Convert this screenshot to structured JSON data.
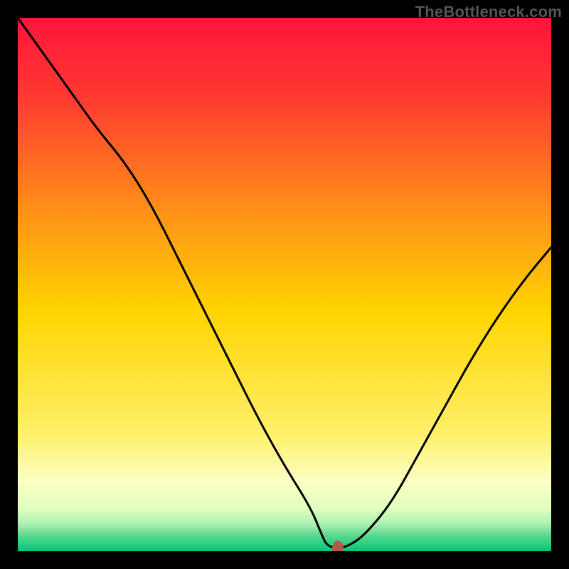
{
  "watermark": "TheBottleneck.com",
  "colors": {
    "top": "#ff143c",
    "upper_mid": "#ff7a1a",
    "mid": "#ffd400",
    "lower_mid": "#fff58a",
    "low_yellow": "#fcffc4",
    "pale": "#e8ffc8",
    "light_green": "#9cf0b0",
    "green": "#00c878",
    "frame": "#000000",
    "curve": "#000000",
    "marker": "#b4594a"
  },
  "chart_data": {
    "type": "line",
    "title": "",
    "xlabel": "",
    "ylabel": "",
    "xlim": [
      0,
      100
    ],
    "ylim": [
      0,
      100
    ],
    "x": [
      0,
      5,
      10,
      15,
      20,
      25,
      30,
      35,
      40,
      45,
      50,
      55,
      57,
      58,
      60,
      62,
      65,
      70,
      75,
      80,
      85,
      90,
      95,
      100
    ],
    "y": [
      100,
      93,
      86,
      79,
      73,
      65,
      55,
      45,
      35,
      25,
      16,
      8,
      3,
      1,
      0.5,
      1,
      3,
      9,
      18,
      27,
      36,
      44,
      51,
      57
    ],
    "marker": {
      "x": 60,
      "y": 0.5
    },
    "annotations": []
  }
}
